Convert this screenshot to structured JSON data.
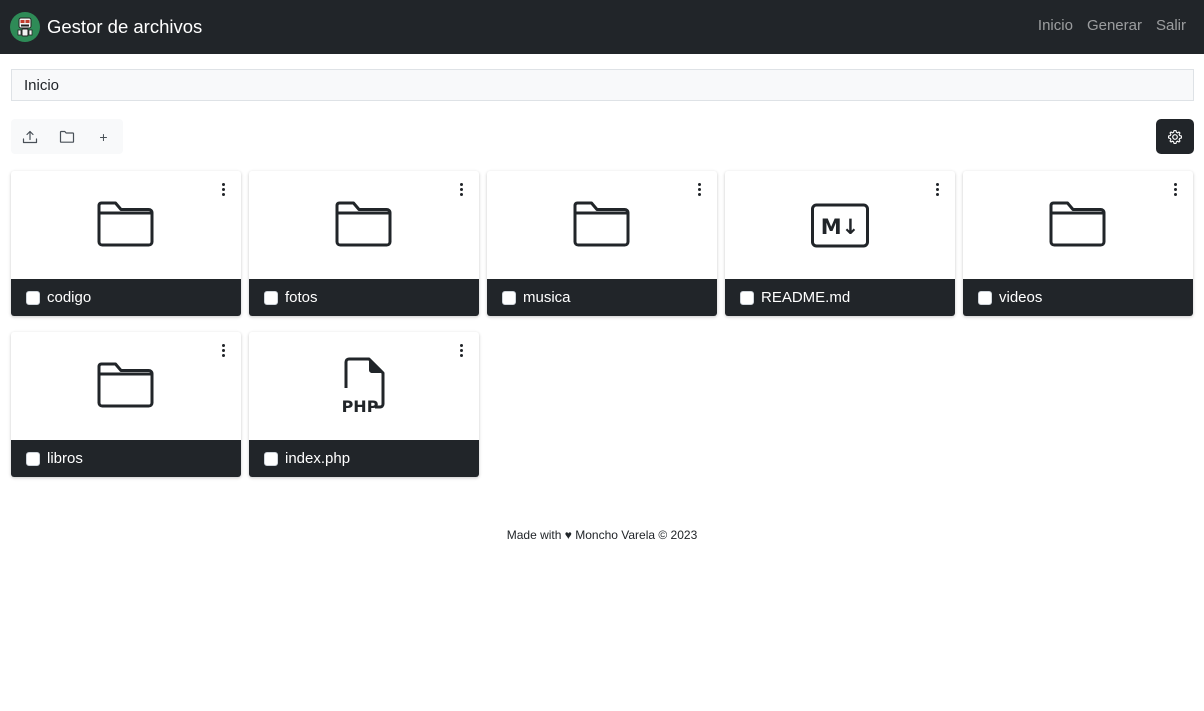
{
  "app": {
    "title": "Gestor de archivos",
    "logo_icon": "robot-avatar-icon"
  },
  "nav": {
    "links": [
      {
        "label": "Inicio"
      },
      {
        "label": "Generar"
      },
      {
        "label": "Salir"
      }
    ]
  },
  "breadcrumb": {
    "current": "Inicio"
  },
  "toolbar": {
    "buttons": [
      {
        "icon": "upload-icon"
      },
      {
        "icon": "folder-icon"
      },
      {
        "icon": "plus-icon",
        "glyph": "+"
      }
    ],
    "settings_icon": "gear-icon"
  },
  "files": [
    {
      "name": "codigo",
      "type": "folder",
      "icon": "folder-icon"
    },
    {
      "name": "fotos",
      "type": "folder",
      "icon": "folder-icon"
    },
    {
      "name": "musica",
      "type": "folder",
      "icon": "folder-icon"
    },
    {
      "name": "README.md",
      "type": "markdown",
      "icon": "markdown-file-icon",
      "badge": "M↓"
    },
    {
      "name": "videos",
      "type": "folder",
      "icon": "folder-icon"
    },
    {
      "name": "libros",
      "type": "folder",
      "icon": "folder-icon"
    },
    {
      "name": "index.php",
      "type": "php",
      "icon": "php-file-icon",
      "badge": "PHP"
    }
  ],
  "footer": {
    "text": "Made with ♥ Moncho Varela © 2023"
  },
  "colors": {
    "navbar_bg": "#212529",
    "card_footer_bg": "#212529",
    "breadcrumb_bg": "#f8f9fa",
    "logo_green": "#2e8b57"
  }
}
